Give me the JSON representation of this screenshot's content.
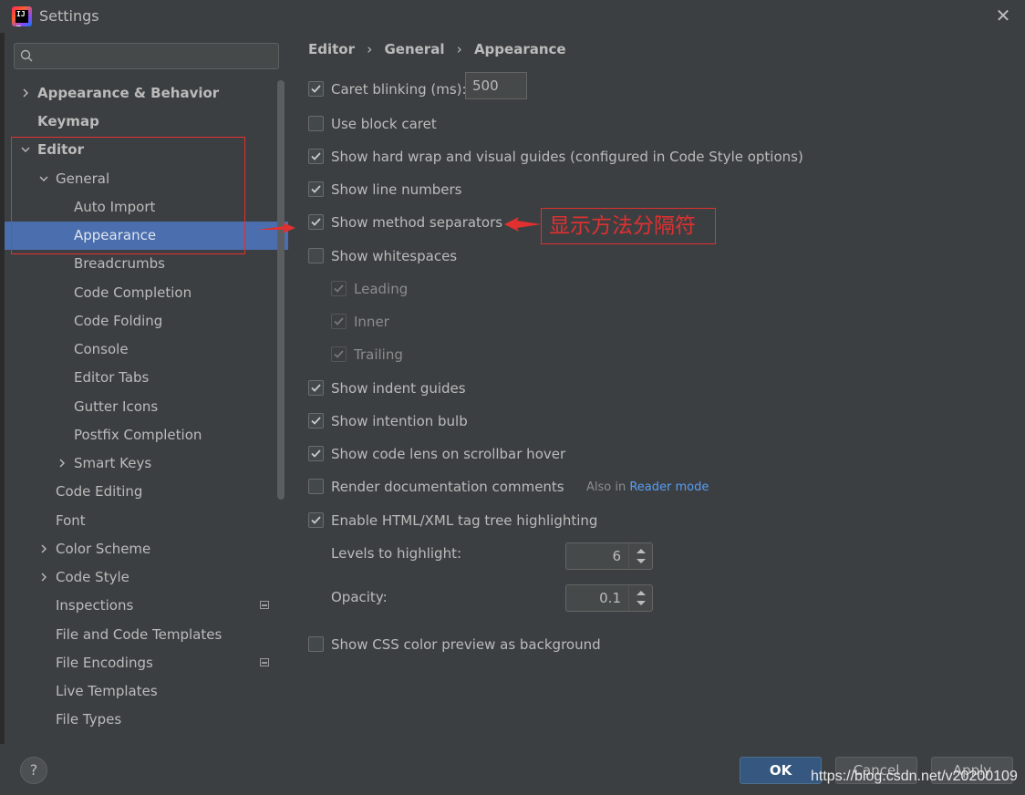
{
  "window": {
    "title": "Settings"
  },
  "search": {
    "placeholder": ""
  },
  "tree": [
    {
      "label": "Appearance & Behavior",
      "bold": true,
      "chevron": "right",
      "indent": 0
    },
    {
      "label": "Keymap",
      "bold": true,
      "chevron": "",
      "indent": 0
    },
    {
      "label": "Editor",
      "bold": true,
      "chevron": "down",
      "indent": 0
    },
    {
      "label": "General",
      "bold": false,
      "chevron": "down",
      "indent": 1
    },
    {
      "label": "Auto Import",
      "bold": false,
      "chevron": "",
      "indent": 2
    },
    {
      "label": "Appearance",
      "bold": false,
      "chevron": "",
      "indent": 2,
      "selected": true
    },
    {
      "label": "Breadcrumbs",
      "bold": false,
      "chevron": "",
      "indent": 2
    },
    {
      "label": "Code Completion",
      "bold": false,
      "chevron": "",
      "indent": 2
    },
    {
      "label": "Code Folding",
      "bold": false,
      "chevron": "",
      "indent": 2
    },
    {
      "label": "Console",
      "bold": false,
      "chevron": "",
      "indent": 2
    },
    {
      "label": "Editor Tabs",
      "bold": false,
      "chevron": "",
      "indent": 2
    },
    {
      "label": "Gutter Icons",
      "bold": false,
      "chevron": "",
      "indent": 2
    },
    {
      "label": "Postfix Completion",
      "bold": false,
      "chevron": "",
      "indent": 2
    },
    {
      "label": "Smart Keys",
      "bold": false,
      "chevron": "right",
      "indent": 2
    },
    {
      "label": "Code Editing",
      "bold": false,
      "chevron": "",
      "indent": 1
    },
    {
      "label": "Font",
      "bold": false,
      "chevron": "",
      "indent": 1
    },
    {
      "label": "Color Scheme",
      "bold": false,
      "chevron": "right",
      "indent": 1
    },
    {
      "label": "Code Style",
      "bold": false,
      "chevron": "right",
      "indent": 1
    },
    {
      "label": "Inspections",
      "bold": false,
      "chevron": "",
      "indent": 1,
      "badge": true
    },
    {
      "label": "File and Code Templates",
      "bold": false,
      "chevron": "",
      "indent": 1
    },
    {
      "label": "File Encodings",
      "bold": false,
      "chevron": "",
      "indent": 1,
      "badge": true
    },
    {
      "label": "Live Templates",
      "bold": false,
      "chevron": "",
      "indent": 1
    },
    {
      "label": "File Types",
      "bold": false,
      "chevron": "",
      "indent": 1
    }
  ],
  "breadcrumb": [
    "Editor",
    "General",
    "Appearance"
  ],
  "breadcrumb_sep": "›",
  "options": {
    "caret_blinking": {
      "label": "Caret blinking (ms):",
      "checked": true,
      "value": "500"
    },
    "block_caret": {
      "label": "Use block caret",
      "checked": false
    },
    "hard_wrap": {
      "label": "Show hard wrap and visual guides (configured in Code Style options)",
      "checked": true
    },
    "line_numbers": {
      "label": "Show line numbers",
      "checked": true
    },
    "method_separators": {
      "label": "Show method separators",
      "checked": true
    },
    "whitespaces": {
      "label": "Show whitespaces",
      "checked": false
    },
    "leading": {
      "label": "Leading",
      "checked": true,
      "disabled": true
    },
    "inner": {
      "label": "Inner",
      "checked": true,
      "disabled": true
    },
    "trailing": {
      "label": "Trailing",
      "checked": true,
      "disabled": true
    },
    "indent_guides": {
      "label": "Show indent guides",
      "checked": true
    },
    "intention_bulb": {
      "label": "Show intention bulb",
      "checked": true
    },
    "code_lens": {
      "label": "Show code lens on scrollbar hover",
      "checked": true
    },
    "render_docs": {
      "label": "Render documentation comments",
      "checked": false,
      "also_prefix": "Also in",
      "also_link": "Reader mode"
    },
    "tag_tree": {
      "label": "Enable HTML/XML tag tree highlighting",
      "checked": true
    },
    "levels": {
      "label": "Levels to highlight:",
      "value": "6"
    },
    "opacity": {
      "label": "Opacity:",
      "value": "0.1"
    },
    "css_color": {
      "label": "Show CSS color preview as background",
      "checked": false
    }
  },
  "annotation": {
    "text": "显示方法分隔符",
    "color": "#e03030"
  },
  "footer": {
    "help": "?",
    "ok": "OK",
    "cancel": "Cancel",
    "apply": "Apply"
  },
  "watermark": "https://blog.csdn.net/v20200109",
  "colors": {
    "background": "#3c3f41",
    "selection": "#4b6eaf",
    "accent_button": "#365880",
    "link": "#589df6"
  }
}
